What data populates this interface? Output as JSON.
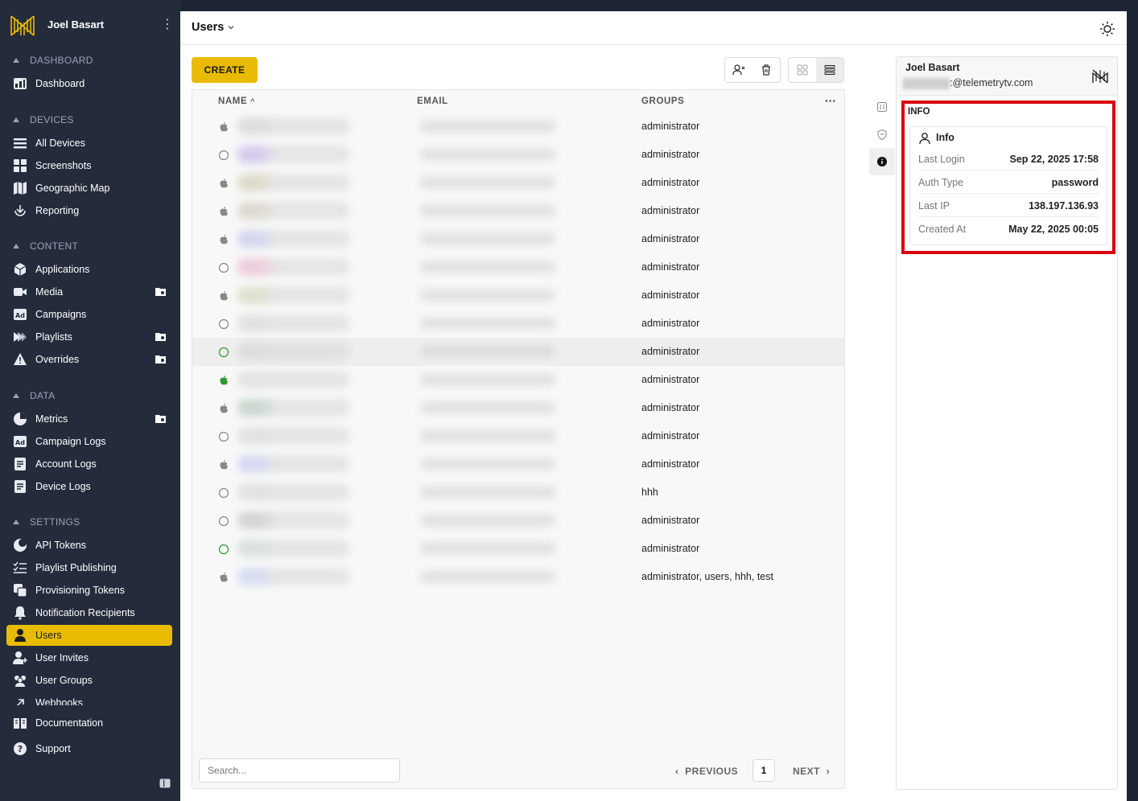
{
  "sidebar": {
    "user_name": "Joel Basart",
    "sections": [
      {
        "title": "DASHBOARD",
        "items": [
          {
            "label": "Dashboard"
          }
        ]
      },
      {
        "title": "DEVICES",
        "items": [
          {
            "label": "All Devices"
          },
          {
            "label": "Screenshots"
          },
          {
            "label": "Geographic Map"
          },
          {
            "label": "Reporting"
          }
        ]
      },
      {
        "title": "CONTENT",
        "items": [
          {
            "label": "Applications"
          },
          {
            "label": "Media"
          },
          {
            "label": "Campaigns"
          },
          {
            "label": "Playlists"
          },
          {
            "label": "Overrides"
          }
        ]
      },
      {
        "title": "DATA",
        "items": [
          {
            "label": "Metrics"
          },
          {
            "label": "Campaign Logs"
          },
          {
            "label": "Account Logs"
          },
          {
            "label": "Device Logs"
          }
        ]
      },
      {
        "title": "SETTINGS",
        "items": [
          {
            "label": "API Tokens"
          },
          {
            "label": "Playlist Publishing"
          },
          {
            "label": "Provisioning Tokens"
          },
          {
            "label": "Notification Recipients"
          },
          {
            "label": "Users"
          },
          {
            "label": "User Invites"
          },
          {
            "label": "User Groups"
          },
          {
            "label": "Webhooks"
          }
        ]
      }
    ],
    "footer": [
      {
        "label": "Documentation"
      },
      {
        "label": "Support"
      }
    ],
    "active_item": "Users",
    "accent_color": "#e8bb00"
  },
  "header": {
    "title": "Users"
  },
  "toolbar": {
    "create_label": "CREATE"
  },
  "table": {
    "columns": [
      "NAME",
      "EMAIL",
      "GROUPS"
    ],
    "sort_indicator": "^",
    "rows": [
      {
        "status": "apple",
        "groups": "administrator"
      },
      {
        "status": "circle",
        "groups": "administrator"
      },
      {
        "status": "apple",
        "groups": "administrator"
      },
      {
        "status": "apple",
        "groups": "administrator"
      },
      {
        "status": "apple",
        "groups": "administrator"
      },
      {
        "status": "circle",
        "groups": "administrator"
      },
      {
        "status": "apple",
        "groups": "administrator"
      },
      {
        "status": "circle",
        "groups": "administrator"
      },
      {
        "status": "circle-green",
        "groups": "administrator"
      },
      {
        "status": "apple-green",
        "groups": "administrator"
      },
      {
        "status": "apple",
        "groups": "administrator"
      },
      {
        "status": "circle",
        "groups": "administrator"
      },
      {
        "status": "apple",
        "groups": "administrator"
      },
      {
        "status": "circle",
        "groups": "hhh"
      },
      {
        "status": "circle",
        "groups": "administrator"
      },
      {
        "status": "circle-green",
        "groups": "administrator"
      },
      {
        "status": "apple",
        "groups": "administrator, users, hhh, test"
      }
    ],
    "search_placeholder": "Search...",
    "pagination": {
      "previous": "PREVIOUS",
      "page": "1",
      "next": "NEXT"
    }
  },
  "detail_panel": {
    "name": "Joel Basart",
    "email_suffix": ":@telemetrytv.com",
    "section_title": "INFO",
    "card_title": "Info",
    "fields": [
      {
        "key": "Last Login",
        "value": "Sep 22, 2025 17:58"
      },
      {
        "key": "Auth Type",
        "value": "password"
      },
      {
        "key": "Last IP",
        "value": "138.197.136.93"
      },
      {
        "key": "Created At",
        "value": "May 22, 2025 00:05"
      }
    ]
  }
}
